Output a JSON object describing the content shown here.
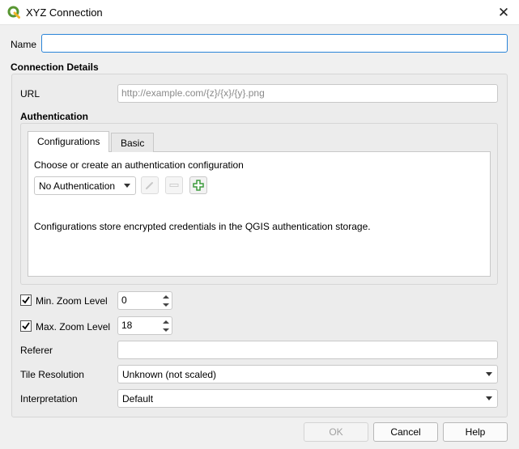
{
  "window": {
    "title": "XYZ Connection",
    "close_glyph": "✕"
  },
  "form": {
    "name_label": "Name",
    "name_value": "",
    "connection_details_label": "Connection Details",
    "url_label": "URL",
    "url_placeholder": "http://example.com/{z}/{x}/{y}.png",
    "url_value": ""
  },
  "authentication": {
    "section_label": "Authentication",
    "tabs": [
      {
        "label": "Configurations",
        "active": true
      },
      {
        "label": "Basic",
        "active": false
      }
    ],
    "choose_text": "Choose or create an authentication configuration",
    "auth_combo_value": "No Authentication",
    "info_text": "Configurations store encrypted credentials in the QGIS authentication storage."
  },
  "zoom": {
    "min_label": "Min. Zoom Level",
    "min_checked": true,
    "min_value": "0",
    "max_label": "Max. Zoom Level",
    "max_checked": true,
    "max_value": "18"
  },
  "referer": {
    "label": "Referer",
    "value": ""
  },
  "tile_resolution": {
    "label": "Tile Resolution",
    "value": "Unknown (not scaled)"
  },
  "interpretation": {
    "label": "Interpretation",
    "value": "Default"
  },
  "buttons": {
    "ok": "OK",
    "cancel": "Cancel",
    "help": "Help"
  },
  "icons": {
    "app": "qgis-logo-icon",
    "edit": "pencil-icon",
    "remove": "minus-icon",
    "add": "plus-icon",
    "check": "check-icon"
  },
  "colors": {
    "qgis_green": "#589632",
    "focus_blue": "#2a84d8",
    "add_green": "#3c9a3c"
  }
}
